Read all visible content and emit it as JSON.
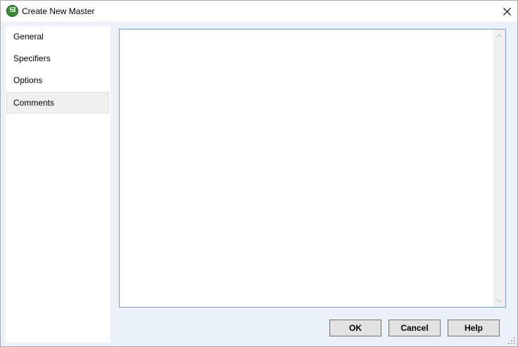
{
  "window": {
    "title": "Create New Master",
    "app_icon_text": "SI",
    "app_icon_color": "#3c8a37"
  },
  "sidebar": {
    "items": [
      {
        "label": "General",
        "selected": false
      },
      {
        "label": "Specifiers",
        "selected": false
      },
      {
        "label": "Options",
        "selected": false
      },
      {
        "label": "Comments",
        "selected": true
      }
    ]
  },
  "comments": {
    "value": ""
  },
  "buttons": {
    "ok": "OK",
    "cancel": "Cancel",
    "help": "Help"
  },
  "colors": {
    "dialog_background": "#ecf0f9",
    "textarea_border": "#7a9cc6"
  }
}
